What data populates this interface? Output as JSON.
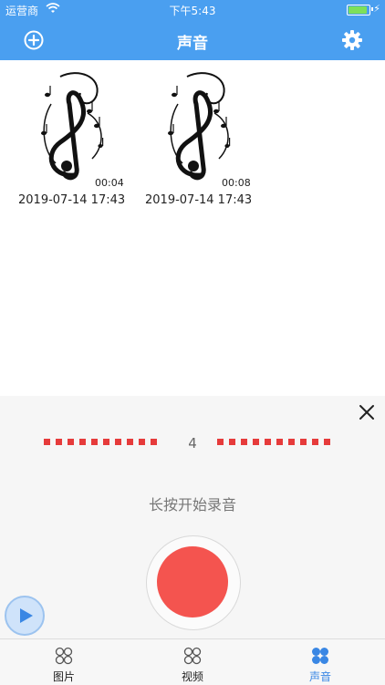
{
  "status_bar": {
    "carrier": "运营商",
    "time": "下午5:43"
  },
  "nav": {
    "title": "声音"
  },
  "recordings": [
    {
      "duration": "00:04",
      "date": "2019-07-14 17:43"
    },
    {
      "duration": "00:08",
      "date": "2019-07-14 17:43"
    }
  ],
  "recorder": {
    "counter": "4",
    "hint": "长按开始录音"
  },
  "tabs": [
    {
      "label": "图片"
    },
    {
      "label": "视频"
    },
    {
      "label": "声音"
    }
  ],
  "colors": {
    "accent": "#4a9ff0",
    "record": "#f4544f",
    "dash": "#e63b3b",
    "tab_active": "#3a87e4"
  }
}
